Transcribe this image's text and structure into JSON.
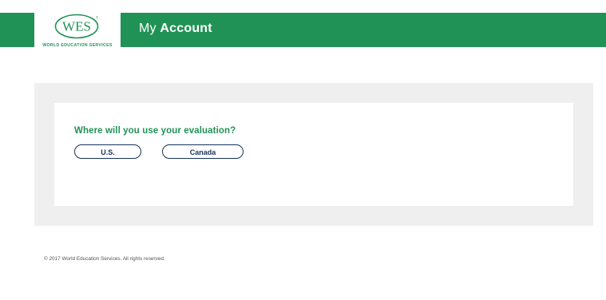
{
  "header": {
    "title_prefix": "My",
    "title_bold": "Account",
    "logo": {
      "mark": "WES",
      "tagline": "WORLD EDUCATION SERVICES",
      "registered": "®"
    }
  },
  "main": {
    "question": "Where will you use your evaluation?",
    "options": [
      {
        "label": "U.S."
      },
      {
        "label": "Canada"
      }
    ]
  },
  "footer": {
    "copyright": "© 2017 World Education Services. All rights reserved."
  },
  "colors": {
    "brand_green": "#209256",
    "navy": "#16325c",
    "panel_gray": "#efefef"
  }
}
